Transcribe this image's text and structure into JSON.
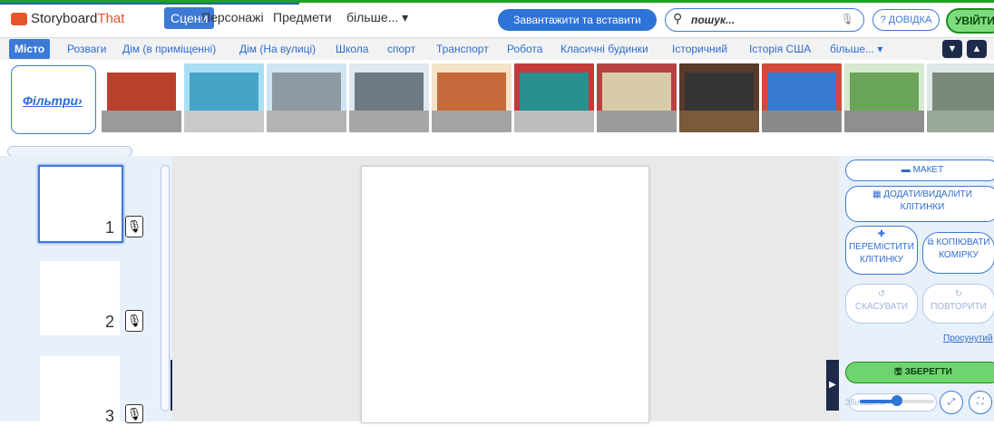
{
  "app": {
    "logo_prefix": "Storyboard",
    "logo_suffix": "That"
  },
  "nav": {
    "items": [
      "Сцени",
      "Персонажі",
      "Предмети",
      "більше... ▾"
    ],
    "upload_label": "Завантажити та вставити",
    "search_placeholder": "пошук...",
    "help_label": "? ДОВІДКА",
    "login_label": "УВІЙТИ"
  },
  "categories": {
    "active": "Місто",
    "items": [
      "Розваги",
      "Дім (в приміщенні)",
      "Дім (На вулиці)",
      "Школа",
      "спорт",
      "Транспорт",
      "Робота",
      "Класичні будинки",
      "Історичний",
      "Історія США",
      "більше... ▾"
    ]
  },
  "filters_label": "Фільтри›",
  "scenes": [
    {
      "name": "city-street-red",
      "sky": "#ffffff",
      "main": "#b8402c",
      "ground": "#9a9a9a"
    },
    {
      "name": "city-shops",
      "sky": "#a9dff5",
      "main": "#48a3c9",
      "ground": "#c9c9c9"
    },
    {
      "name": "skyline",
      "sky": "#cfe6f2",
      "main": "#8d9aa3",
      "ground": "#b3b3b3"
    },
    {
      "name": "street-lamp",
      "sky": "#dfe7ef",
      "main": "#6f7b84",
      "ground": "#a6a6a6"
    },
    {
      "name": "brick-buildings",
      "sky": "#f2e3c9",
      "main": "#c46a3b",
      "ground": "#a4a4a4"
    },
    {
      "name": "green-door",
      "sky": "#c23b3b",
      "main": "#2a8f8f",
      "ground": "#bdbdbd"
    },
    {
      "name": "cafe-patio",
      "sky": "#b84141",
      "main": "#d9cba8",
      "ground": "#9b9b9b"
    },
    {
      "name": "shop-window",
      "sky": "#5a3a2a",
      "main": "#343434",
      "ground": "#7a5a3a"
    },
    {
      "name": "alley",
      "sky": "#d24a3a",
      "main": "#3a7bd2",
      "ground": "#8a8a8a"
    },
    {
      "name": "parking-lot",
      "sky": "#d7e9d0",
      "main": "#6aa55a",
      "ground": "#8f8f8f"
    },
    {
      "name": "cemetery",
      "sky": "#dfe8e8",
      "main": "#7a8a7a",
      "ground": "#9aa89a"
    }
  ],
  "cells": [
    {
      "number": "1",
      "selected": true
    },
    {
      "number": "2",
      "selected": false
    },
    {
      "number": "3",
      "selected": false
    }
  ],
  "right": {
    "layout_label": "МАКЕТ",
    "add_remove_line1": "ДОДАТИ/ВИДАЛИТИ",
    "add_remove_line2": "КЛІТИНКИ",
    "move_line1": "ПЕРЕМІСТИТИ",
    "move_line2": "КЛІТИНКУ",
    "copy_line1": "КОПІЮВАТИ",
    "copy_line2": "КОМІРКУ",
    "undo_label": "СКАСУВАТИ",
    "redo_label": "ПОВТОРИТИ",
    "advanced_label": "Просунутий",
    "save_label": "ЗБЕРЕГТИ",
    "zoom_label": "Збільшити",
    "zoom_level": 0.5
  },
  "colors": {
    "accent": "#3d7ad6",
    "save_green": "#6fd46f",
    "dark_button": "#1e2a4a"
  }
}
